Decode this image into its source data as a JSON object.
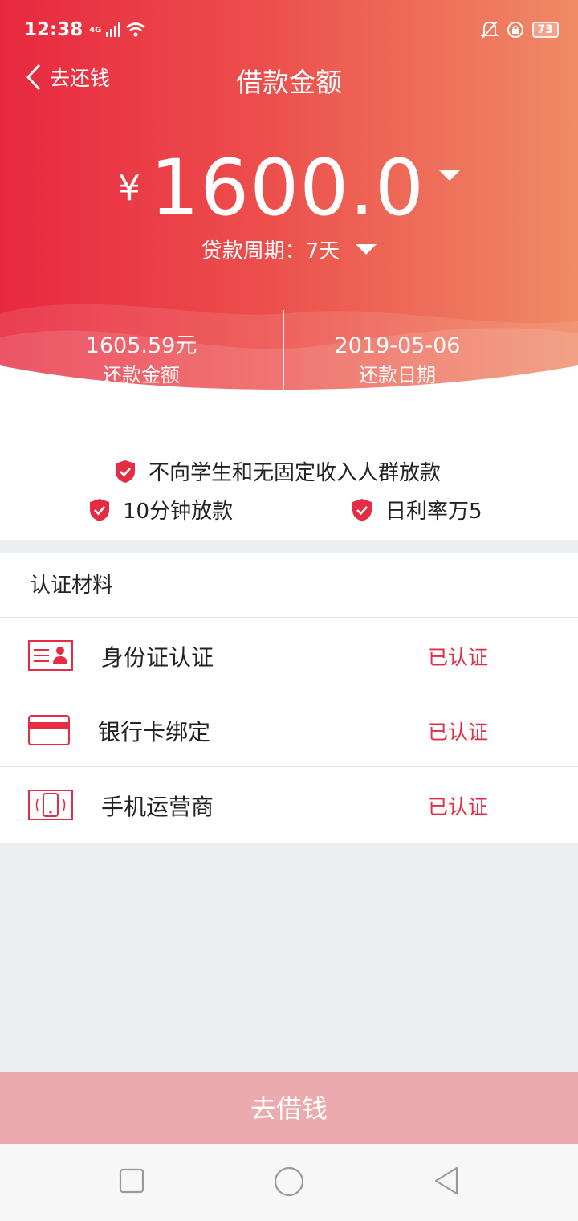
{
  "status_bar": {
    "time": "12:38",
    "network": "4G",
    "battery": "73"
  },
  "nav": {
    "back_label": "去还钱",
    "title": "借款金额"
  },
  "loan": {
    "currency": "¥",
    "amount": "1600.0",
    "period_text": "贷款周期：7天"
  },
  "summary": {
    "repay_amount": "1605.59元",
    "repay_amount_label": "还款金额",
    "repay_date": "2019-05-06",
    "repay_date_label": "还款日期"
  },
  "features": [
    "不向学生和无固定收入人群放款",
    "10分钟放款",
    "日利率万5"
  ],
  "verification": {
    "title": "认证材料",
    "items": [
      {
        "label": "身份证认证",
        "status": "已认证",
        "icon": "id-card-icon"
      },
      {
        "label": "银行卡绑定",
        "status": "已认证",
        "icon": "bank-card-icon"
      },
      {
        "label": "手机运营商",
        "status": "已认证",
        "icon": "phone-icon"
      }
    ]
  },
  "cta": {
    "label": "去借钱"
  },
  "colors": {
    "accent": "#e52c45",
    "gradient_start": "#e8283f",
    "gradient_end": "#f08a66",
    "cta_bg": "#ebaaad"
  }
}
